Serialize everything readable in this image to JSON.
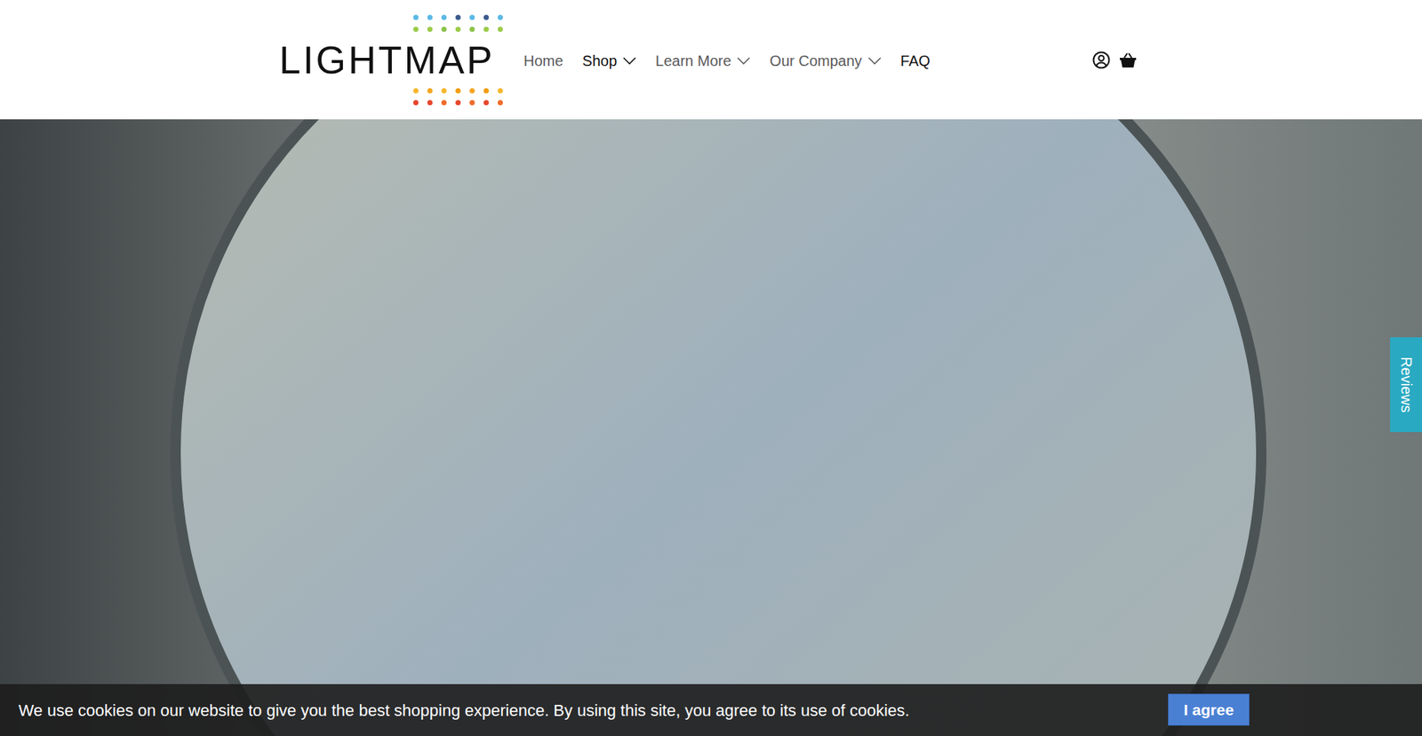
{
  "logo": {
    "text": "LIGHTMAP",
    "top_dots": [
      [
        "#5bb8e6",
        "#5bb8e6",
        "#5bb8e6",
        "#3a5a8c",
        "#5bb8e6",
        "#3a5a8c",
        "#5bb8e6"
      ],
      [
        "#9ccc4a",
        "#9ccc4a",
        "#8bc34a",
        "#9ccc4a",
        "#8bc34a",
        "#9ccc4a",
        "#9ccc4a"
      ]
    ],
    "bottom_dots": [
      [
        "#f5b82e",
        "#f5a623",
        "#f5b82e",
        "#f39c12",
        "#f5a623",
        "#f39c12",
        "#f5b82e"
      ],
      [
        "#e8452c",
        "#e8452c",
        "#ef6a2a",
        "#e8452c",
        "#ef6a2a",
        "#e8452c",
        "#ef6a2a"
      ]
    ]
  },
  "nav": [
    {
      "label": "Home",
      "has_menu": false,
      "emphasis": false
    },
    {
      "label": "Shop",
      "has_menu": true,
      "emphasis": true
    },
    {
      "label": "Learn More",
      "has_menu": true,
      "emphasis": false
    },
    {
      "label": "Our Company",
      "has_menu": true,
      "emphasis": false
    },
    {
      "label": "FAQ",
      "has_menu": false,
      "emphasis": true
    }
  ],
  "reviews_tab": "Reviews",
  "cookie_bar": {
    "message": "We use cookies on our website to give you the best shopping experience. By using this site, you agree to its use of cookies.",
    "button": "I agree"
  }
}
